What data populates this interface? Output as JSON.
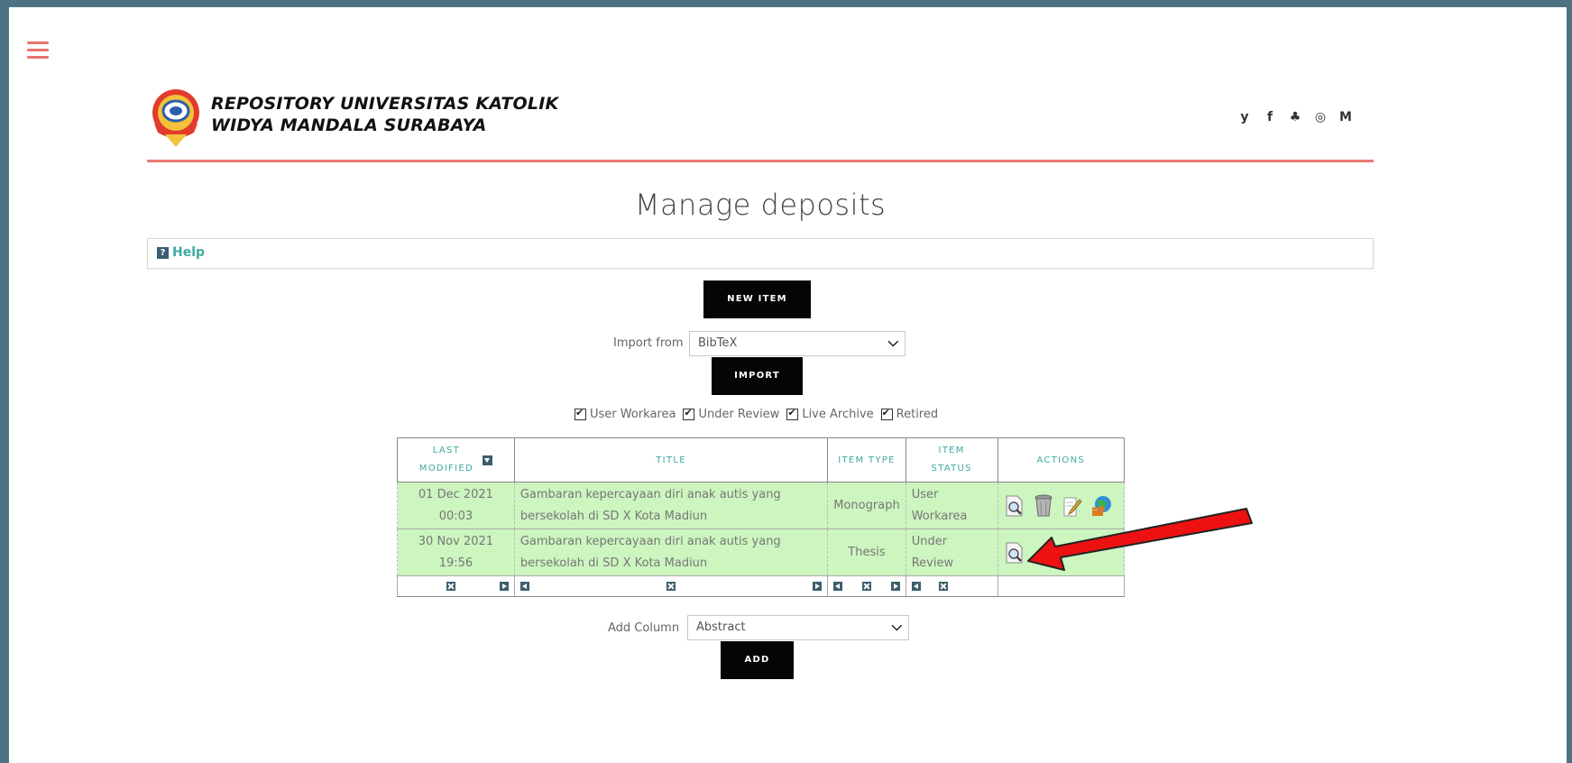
{
  "brand": {
    "line1": "REPOSITORY UNIVERSITAS KATOLIK",
    "line2": "WIDYA MANDALA SURABAYA"
  },
  "social_icons": [
    "twitter-icon",
    "facebook-icon",
    "snapchat-icon",
    "instagram-icon",
    "mendeley-icon"
  ],
  "social_glyphs": [
    "y",
    "f",
    "♣",
    "◎",
    "M"
  ],
  "page_title": "Manage deposits",
  "help": {
    "label": "Help",
    "icon": "?"
  },
  "new_item": {
    "label": "NEW ITEM"
  },
  "import": {
    "label": "Import from",
    "selected": "BibTeX",
    "button": "IMPORT"
  },
  "filters": [
    "User Workarea",
    "Under Review",
    "Live Archive",
    "Retired"
  ],
  "table": {
    "headers": {
      "last_modified_1": "LAST",
      "last_modified_2": "MODIFIED",
      "title": "TITLE",
      "item_type": "ITEM TYPE",
      "item_status_1": "ITEM",
      "item_status_2": "STATUS",
      "actions": "ACTIONS"
    },
    "rows": [
      {
        "date": "01 Dec 2021",
        "time": "00:03",
        "title_1": "Gambaran kepercayaan diri anak autis yang",
        "title_2": "bersekolah di SD X Kota Madiun",
        "type": "Monograph",
        "status_1": "User",
        "status_2": "Workarea",
        "actions": [
          "view-icon",
          "delete-icon",
          "edit-icon",
          "deposit-icon"
        ]
      },
      {
        "date": "30 Nov 2021",
        "time": "19:56",
        "title_1": "Gambaran kepercayaan diri anak autis yang",
        "title_2": "bersekolah di SD X Kota Madiun",
        "type": "Thesis",
        "status_1": "Under",
        "status_2": "Review",
        "actions": [
          "view-icon"
        ]
      }
    ]
  },
  "add_column": {
    "label": "Add Column",
    "selected": "Abstract",
    "button": "ADD"
  },
  "colors": {
    "frame": "#4d7283",
    "accent": "#e8736c",
    "row_green": "#ccf5bf",
    "header_text": "#3eaaa0",
    "annotation_arrow": "#ee1111"
  }
}
